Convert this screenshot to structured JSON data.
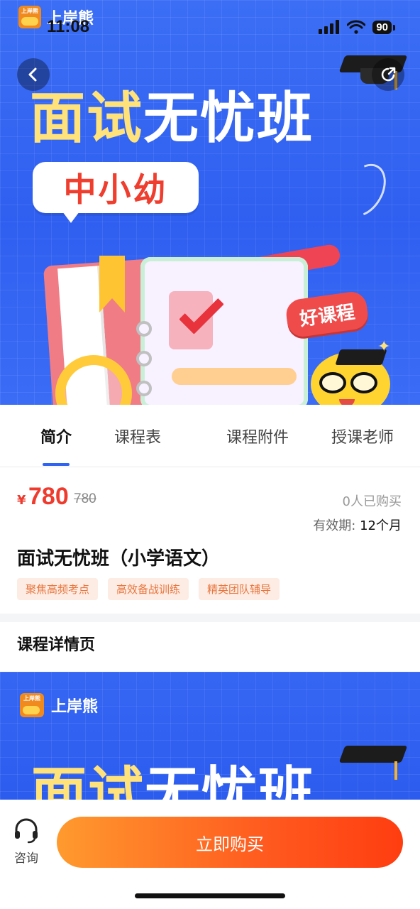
{
  "status_bar": {
    "app_name": "上岸熊",
    "logo_mini_text": "上岸熊",
    "time": "11:08",
    "battery": "90"
  },
  "hero": {
    "title_part1": "面试",
    "title_part2": "无忧班",
    "tag": "中小幼",
    "badge": "好课程"
  },
  "tabs": [
    {
      "label": "简介",
      "active": true
    },
    {
      "label": "课程表",
      "active": false
    },
    {
      "label": "课程附件",
      "active": false
    },
    {
      "label": "授课老师",
      "active": false
    }
  ],
  "course": {
    "currency": "¥",
    "price": "780",
    "original_price": "780",
    "buyers": "0人已购买",
    "validity_label": "有效期:",
    "validity_value": "12个月",
    "title": "面试无忧班（小学语文）",
    "tags": [
      "聚焦高频考点",
      "高效备战训练",
      "精英团队辅导"
    ]
  },
  "detail": {
    "heading": "课程详情页",
    "logo_text": "上岸熊",
    "title_part1": "面试",
    "title_part2": "无忧班"
  },
  "bottom_bar": {
    "consult_label": "咨询",
    "buy_label": "立即购买"
  },
  "colors": {
    "brand_blue": "#2f5ff0",
    "price_red": "#ee3b2e",
    "buy_gradient_start": "#ff9a2e",
    "buy_gradient_end": "#ff3d10",
    "tab_indicator": "#2f64f3"
  }
}
